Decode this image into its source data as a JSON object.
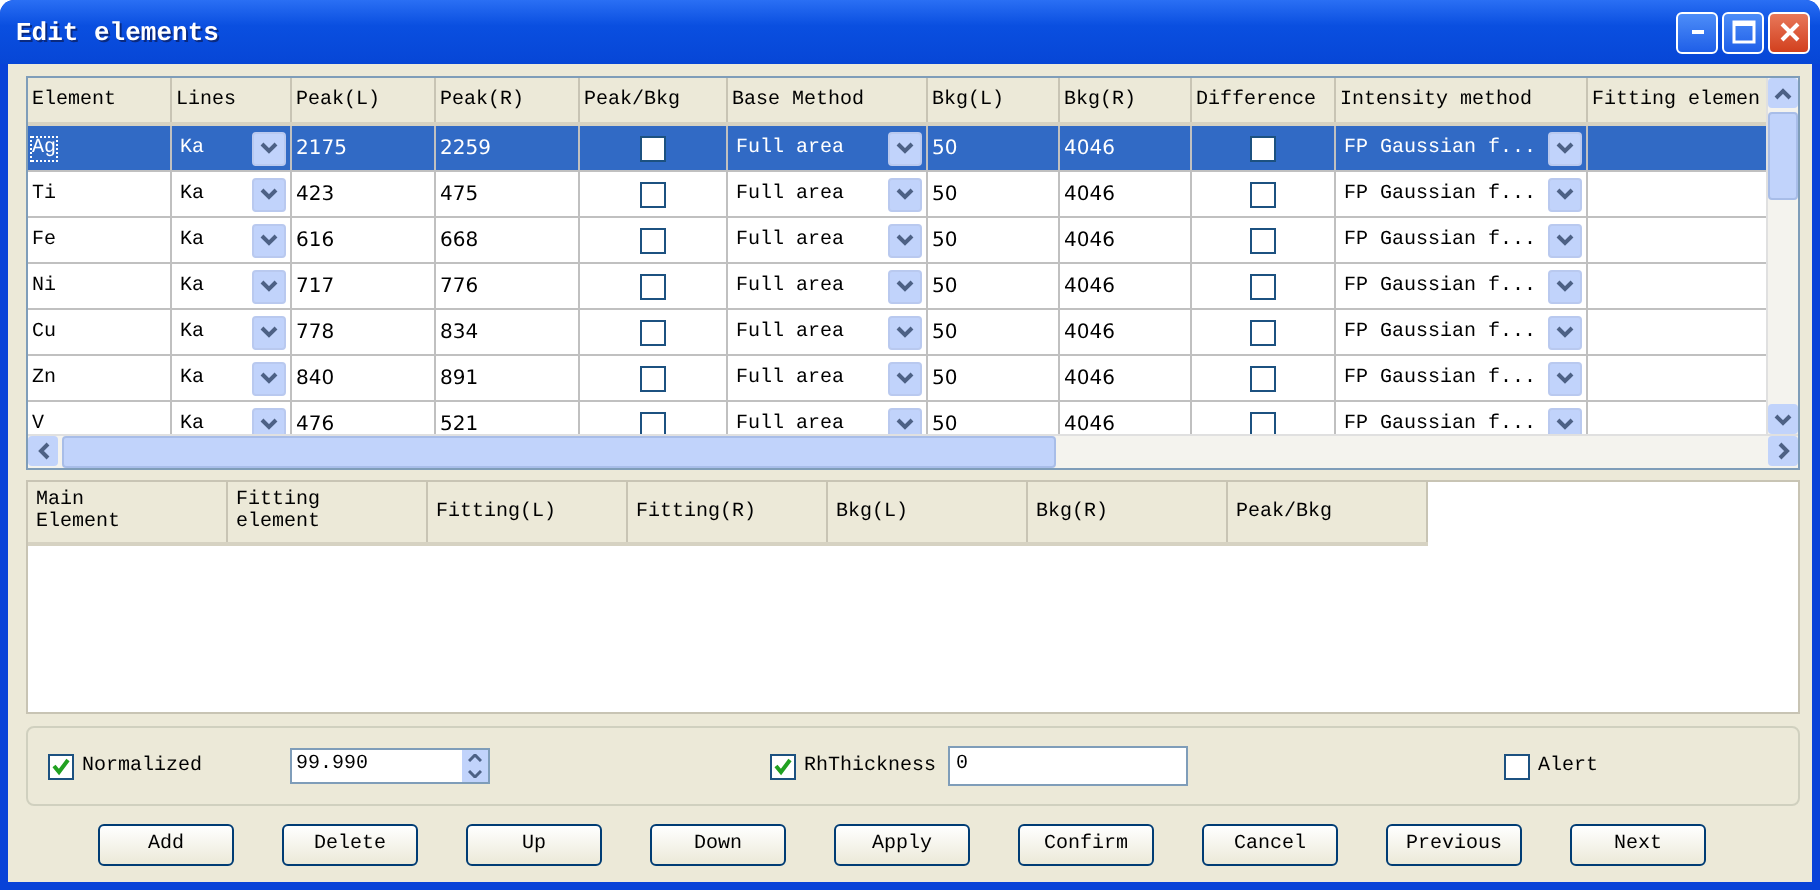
{
  "window": {
    "title": "Edit elements"
  },
  "elements_table": {
    "columns": [
      "Element",
      "Lines",
      "Peak(L)",
      "Peak(R)",
      "Peak/Bkg",
      "Base Method",
      "Bkg(L)",
      "Bkg(R)",
      "Difference",
      "Intensity method",
      "Fitting elemen"
    ],
    "rows": [
      {
        "element": "Ag",
        "lines": "Ka",
        "peak_l": "2175",
        "peak_r": "2259",
        "peak_bkg": false,
        "base_method": "Full area",
        "bkg_l": "50",
        "bkg_r": "4046",
        "difference": false,
        "intensity_method": "FP Gaussian f...",
        "selected": true
      },
      {
        "element": "Ti",
        "lines": "Ka",
        "peak_l": "423",
        "peak_r": "475",
        "peak_bkg": false,
        "base_method": "Full area",
        "bkg_l": "50",
        "bkg_r": "4046",
        "difference": false,
        "intensity_method": "FP Gaussian f...",
        "selected": false
      },
      {
        "element": "Fe",
        "lines": "Ka",
        "peak_l": "616",
        "peak_r": "668",
        "peak_bkg": false,
        "base_method": "Full area",
        "bkg_l": "50",
        "bkg_r": "4046",
        "difference": false,
        "intensity_method": "FP Gaussian f...",
        "selected": false
      },
      {
        "element": "Ni",
        "lines": "Ka",
        "peak_l": "717",
        "peak_r": "776",
        "peak_bkg": false,
        "base_method": "Full area",
        "bkg_l": "50",
        "bkg_r": "4046",
        "difference": false,
        "intensity_method": "FP Gaussian f...",
        "selected": false
      },
      {
        "element": "Cu",
        "lines": "Ka",
        "peak_l": "778",
        "peak_r": "834",
        "peak_bkg": false,
        "base_method": "Full area",
        "bkg_l": "50",
        "bkg_r": "4046",
        "difference": false,
        "intensity_method": "FP Gaussian f...",
        "selected": false
      },
      {
        "element": "Zn",
        "lines": "Ka",
        "peak_l": "840",
        "peak_r": "891",
        "peak_bkg": false,
        "base_method": "Full area",
        "bkg_l": "50",
        "bkg_r": "4046",
        "difference": false,
        "intensity_method": "FP Gaussian f...",
        "selected": false
      },
      {
        "element": "V",
        "lines": "Ka",
        "peak_l": "476",
        "peak_r": "521",
        "peak_bkg": false,
        "base_method": "Full area",
        "bkg_l": "50",
        "bkg_r": "4046",
        "difference": false,
        "intensity_method": "FP Gaussian f...",
        "selected": false
      }
    ]
  },
  "fitting_table": {
    "columns": [
      "Main\nElement",
      "Fitting\nelement",
      "Fitting(L)",
      "Fitting(R)",
      "Bkg(L)",
      "Bkg(R)",
      "Peak/Bkg"
    ]
  },
  "options": {
    "normalized": {
      "label": "Normalized",
      "checked": true,
      "value": "99.990"
    },
    "rh_thickness": {
      "label": "RhThickness",
      "checked": true,
      "value": "0"
    },
    "alert": {
      "label": "Alert",
      "checked": false
    }
  },
  "buttons": [
    "Add",
    "Delete",
    "Up",
    "Down",
    "Apply",
    "Confirm",
    "Cancel",
    "Previous",
    "Next"
  ]
}
